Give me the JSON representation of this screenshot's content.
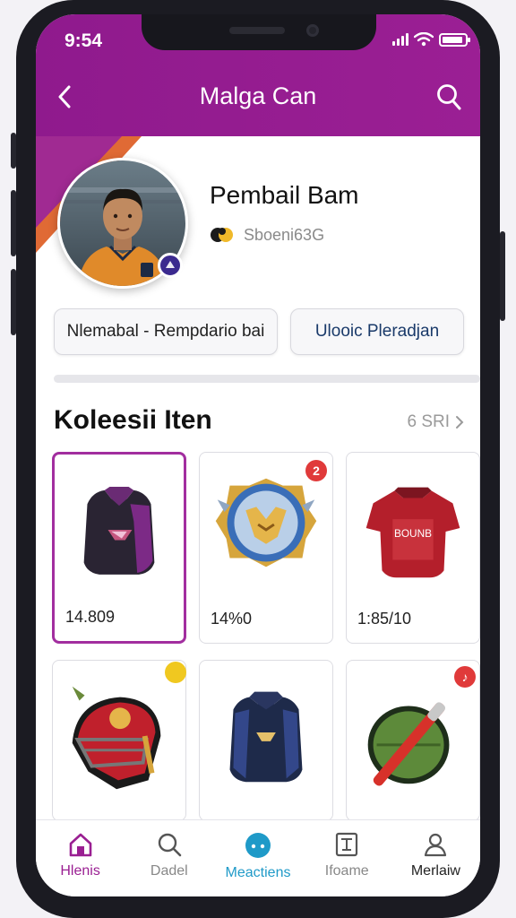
{
  "status_bar": {
    "time": "9:54"
  },
  "header": {
    "title": "Malga Can"
  },
  "profile": {
    "name": "Pembail Bam",
    "handle": "Sboeni63G"
  },
  "actions": {
    "primary_label": "Nlemabal - Rempdario bai",
    "secondary_label": "Ulooic Pleradjan"
  },
  "collection": {
    "title": "Koleesii Iten",
    "count_label": "6 SRI",
    "items": [
      {
        "name": "purple-vest",
        "price": "14.809",
        "selected": true
      },
      {
        "name": "blue-gold-emblem",
        "price": "14%0",
        "badge": "2"
      },
      {
        "name": "red-jersey",
        "price": "1:85/10",
        "jersey_text": "BOUNB"
      },
      {
        "name": "red-helmet",
        "price": ""
      },
      {
        "name": "navy-vest",
        "price": ""
      },
      {
        "name": "green-shield-bat",
        "price": ""
      }
    ]
  },
  "tabbar": {
    "tabs": [
      {
        "label": "Hlenis",
        "icon": "home-icon",
        "state": "active"
      },
      {
        "label": "Dadel",
        "icon": "search-icon",
        "state": "normal"
      },
      {
        "label": "Meactiens",
        "icon": "chat-icon",
        "state": "accent"
      },
      {
        "label": "Ifoame",
        "icon": "frame-icon",
        "state": "normal"
      },
      {
        "label": "Merlaiw",
        "icon": "profile-icon",
        "state": "dark"
      }
    ]
  },
  "colors": {
    "header": "#9b1f94",
    "accent_orange": "#e06a35",
    "selected_border": "#a22e9f",
    "accent_blue": "#1f9ac8"
  }
}
